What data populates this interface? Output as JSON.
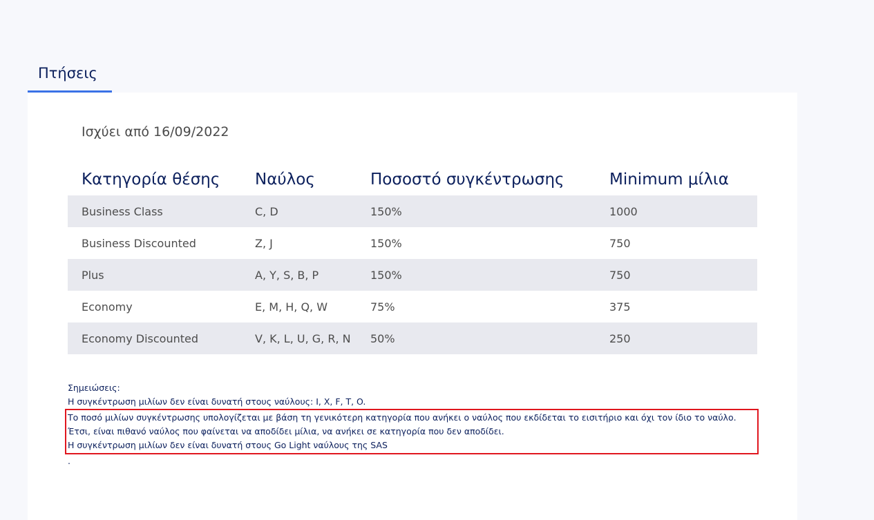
{
  "tabs": [
    {
      "label": "Πτήσεις",
      "active": true
    }
  ],
  "valid_from": "Ισχύει από 16/09/2022",
  "table": {
    "headers": [
      "Κατηγορία θέσης",
      "Ναύλος",
      "Ποσοστό συγκέντρωσης",
      "Minimum μίλια"
    ],
    "rows": [
      [
        "Business Class",
        "C, D",
        "150%",
        "1000"
      ],
      [
        "Business Discounted",
        "Z, J",
        "150%",
        "750"
      ],
      [
        "Plus",
        "A, Y, S, B, P",
        "150%",
        "750"
      ],
      [
        "Economy",
        "E, M, H, Q, W",
        "75%",
        "375"
      ],
      [
        "Economy Discounted",
        "V, K, L, U, G, R, N",
        "50%",
        "250"
      ]
    ]
  },
  "notes": {
    "title": "Σημειώσεις:",
    "line1": "Η συγκέντρωση μιλίων δεν είναι δυνατή στους ναύλους: I, X, F, T, O.",
    "highlighted": [
      "Το ποσό μιλίων συγκέντρωσης υπολογίζεται με βάση τη γενικότερη κατηγορία που ανήκει ο ναύλος που εκδίδεται το εισιτήριο και όχι τον ίδιο το ναύλο. Έτσι, είναι πιθανό ναύλος που φαίνεται να αποδίδει μίλια, να ανήκει σε κατηγορία που δεν αποδίδει.",
      "Η συγκέντρωση μιλίων δεν είναι δυνατή στους Go Light ναύλους της SAS"
    ],
    "trailing": "."
  },
  "colors": {
    "heading": "#0b1f5c",
    "tab_underline": "#3a72e6",
    "row_stripe": "#e8e9ef",
    "highlight_border": "#e0161e"
  }
}
